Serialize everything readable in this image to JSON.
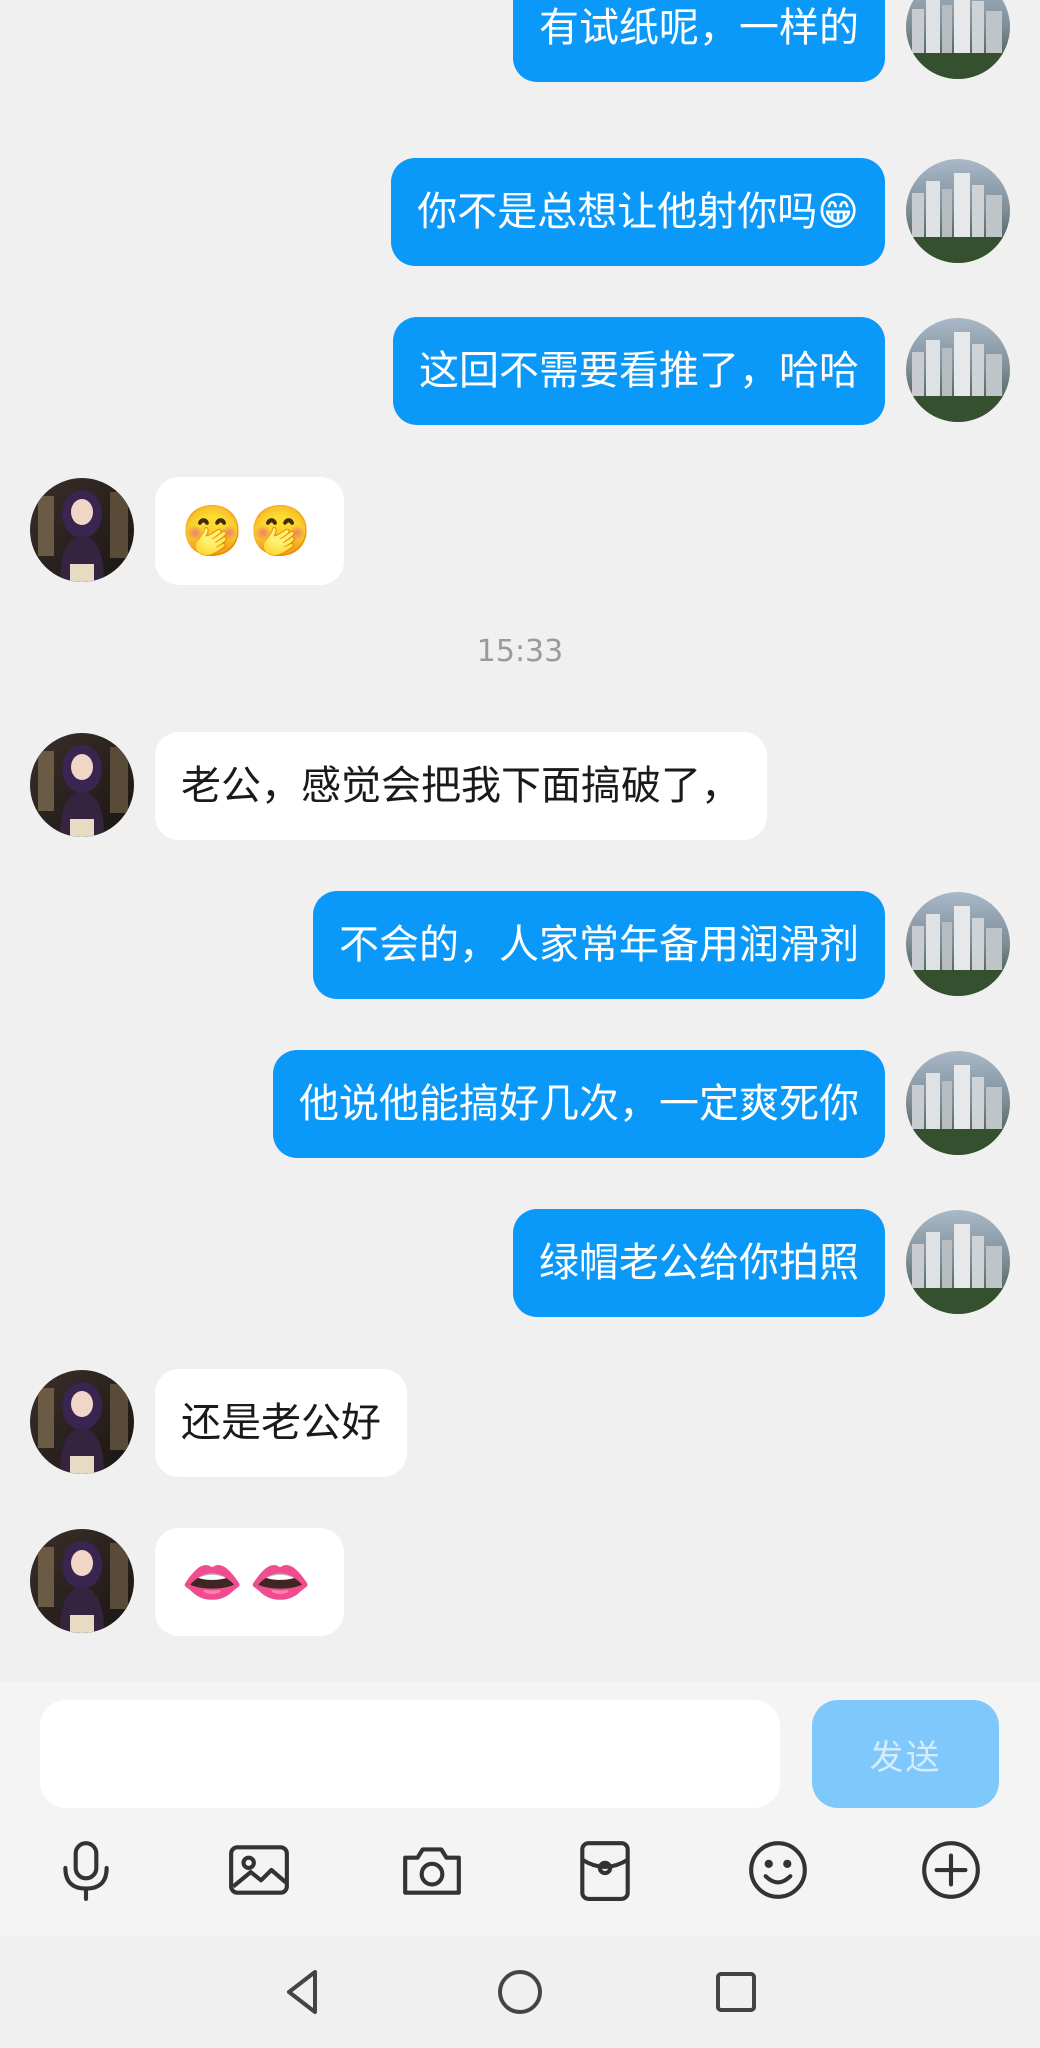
{
  "messages": [
    {
      "side": "self",
      "text": "有试纸呢，一样的"
    },
    {
      "side": "self",
      "text": "你不是总想让他射你吗😁"
    },
    {
      "side": "self",
      "text": "这回不需要看推了，哈哈"
    },
    {
      "side": "other",
      "text": "🤭🤭"
    },
    {
      "side": "other",
      "text": "老公，感觉会把我下面搞破了，"
    },
    {
      "side": "self",
      "text": "不会的，人家常年备用润滑剂"
    },
    {
      "side": "self",
      "text": "他说他能搞好几次，一定爽死你"
    },
    {
      "side": "self",
      "text": "绿帽老公给你拍照"
    },
    {
      "side": "other",
      "text": "还是老公好"
    },
    {
      "side": "other",
      "text": "👄👄"
    }
  ],
  "timestamp": "15:33",
  "composer": {
    "input_value": "",
    "send_label": "发送"
  },
  "toolbar_icons": [
    "microphone-icon",
    "image-icon",
    "camera-icon",
    "red-packet-icon",
    "emoji-icon",
    "add-icon"
  ],
  "colors": {
    "self_bubble": "#0a99f8",
    "other_bubble": "#ffffff",
    "send_button_disabled": "#7ec8fb",
    "background": "#f0f0f0"
  }
}
